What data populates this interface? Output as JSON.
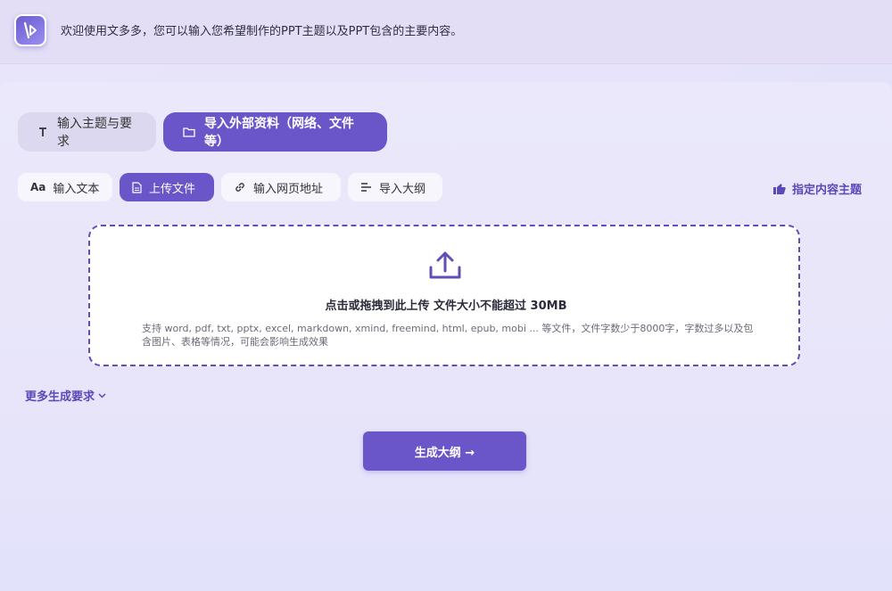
{
  "header": {
    "welcome_text": "欢迎使用文多多，您可以输入您希望制作的PPT主题以及PPT包含的主要内容。"
  },
  "mode_tabs": [
    {
      "label": "输入主题与要求",
      "icon": "text-icon",
      "active": false
    },
    {
      "label": "导入外部资料（网络、文件等）",
      "icon": "folder-icon",
      "active": true
    }
  ],
  "sub_tabs": [
    {
      "label": "输入文本",
      "icon": "font-icon",
      "icon_text": "Aa",
      "active": false
    },
    {
      "label": "上传文件",
      "icon": "file-icon",
      "active": true
    },
    {
      "label": "输入网页地址",
      "icon": "link-icon",
      "active": false
    },
    {
      "label": "导入大纲",
      "icon": "outline-icon",
      "active": false
    }
  ],
  "assign_topic": {
    "label": "指定内容主题",
    "icon": "hand-point-icon"
  },
  "dropzone": {
    "title": "点击或拖拽到此上传 文件大小不能超过 30MB",
    "description": "支持 word, pdf, txt, pptx, excel, markdown, xmind, freemind, html, epub, mobi ... 等文件，文件字数少于8000字，字数过多以及包含图片、表格等情况，可能会影响生成效果",
    "icon": "upload-icon"
  },
  "more_requirements": {
    "label": "更多生成要求",
    "icon": "chevron-down-icon"
  },
  "generate_button": {
    "label": "生成大纲 →"
  },
  "colors": {
    "accent": "#6a56c9",
    "accent_text": "#5a49b8"
  }
}
